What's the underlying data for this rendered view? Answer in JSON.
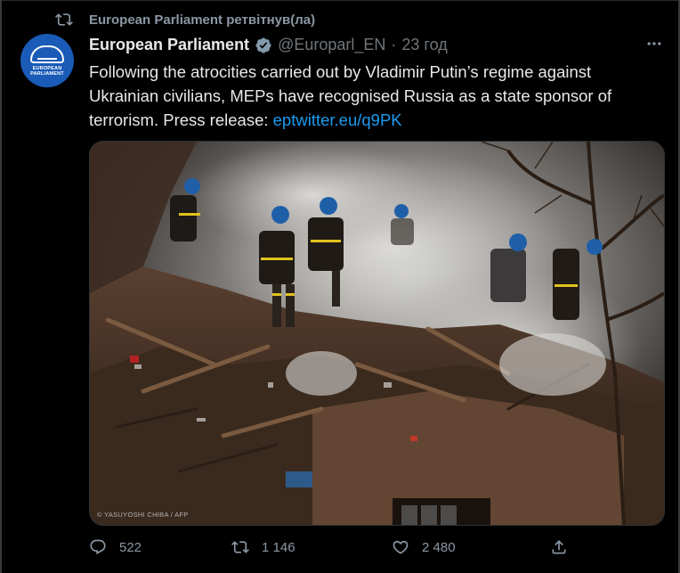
{
  "retweet": {
    "text": "European Parliament ретвітнув(ла)"
  },
  "author": {
    "name": "European Parliament",
    "handle": "@Europarl_EN",
    "separator": "·",
    "time": "23 год",
    "avatar_text": "EUROPEAN PARLIAMENT"
  },
  "tweet": {
    "text": "Following the atrocities carried out by Vladimir Putin’s regime against Ukrainian civilians, MEPs have recognised Russia as a state sponsor of terrorism. Press release: ",
    "link": "eptwitter.eu/q9PK"
  },
  "media": {
    "credit": "© YASUYOSHI CHIBA / AFP"
  },
  "stats": {
    "replies": "522",
    "retweets": "1 146",
    "likes": "2 480"
  },
  "colors": {
    "link": "#1d9bf0",
    "muted": "#71767b",
    "verified": "#829aab",
    "background": "#000000"
  },
  "icons": [
    "retweet-icon",
    "verified-badge-icon",
    "more-icon",
    "reply-icon",
    "like-icon",
    "share-icon"
  ]
}
